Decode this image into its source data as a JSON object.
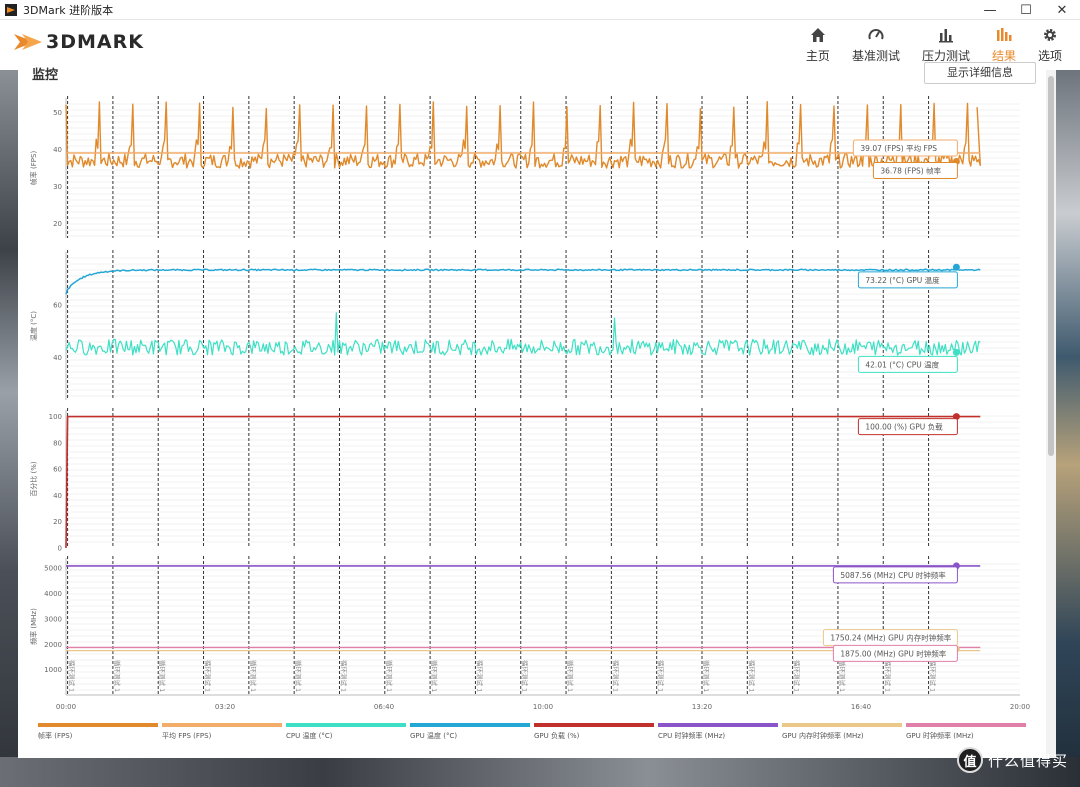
{
  "window": {
    "title": "3DMark 进阶版本",
    "min": "—",
    "max": "☐",
    "close": "✕"
  },
  "header": {
    "logo_text": "3DMARK",
    "nav": [
      {
        "label": "主页",
        "icon": "home-icon"
      },
      {
        "label": "基准测试",
        "icon": "gauge-icon"
      },
      {
        "label": "压力测试",
        "icon": "bars-icon"
      },
      {
        "label": "结果",
        "icon": "results-icon",
        "active": true
      },
      {
        "label": "选项",
        "icon": "gear-icon"
      }
    ]
  },
  "panel": {
    "title": "监控",
    "detail_button": "显示详细信息"
  },
  "colors": {
    "fps": "#e08a2c",
    "avg_fps": "#f2ad6b",
    "cpu_temp": "#3de0c4",
    "gpu_temp": "#25a7d6",
    "gpu_load": "#c0302c",
    "cpu_clock": "#8a55c8",
    "gpu_mem_clock": "#e9c88a",
    "gpu_clock": "#e07fa8",
    "marker_line": "#333333"
  },
  "chart_data": [
    {
      "type": "line",
      "ylabel": "帧率 (FPS)",
      "yticks": [
        20,
        30,
        40,
        50
      ],
      "ylim": [
        16,
        54
      ],
      "series": [
        {
          "name": "帧率 (FPS)",
          "pattern": "periodic spikes",
          "base": 37,
          "spike": 52,
          "period_s": 42
        },
        {
          "name": "平均 FPS (FPS)",
          "values": [
            39.07
          ]
        }
      ],
      "annotations": [
        "39.07 (FPS) 平均 FPS",
        "36.78 (FPS) 帧率"
      ]
    },
    {
      "type": "line",
      "ylabel": "温度 (°C)",
      "yticks": [
        40,
        60
      ],
      "ylim": [
        24,
        80
      ],
      "series": [
        {
          "name": "GPU 温度 (°C)",
          "start": 65,
          "values": [
            73.22
          ]
        },
        {
          "name": "CPU 温度 (°C)",
          "values": [
            42.01
          ]
        }
      ],
      "annotations": [
        "73.22 (°C) GPU 温度",
        "42.01 (°C) CPU 温度"
      ]
    },
    {
      "type": "line",
      "ylabel": "百分比 (%)",
      "yticks": [
        0,
        20,
        40,
        60,
        80,
        100
      ],
      "ylim": [
        0,
        105
      ],
      "series": [
        {
          "name": "GPU 负载 (%)",
          "values": [
            0,
            100
          ]
        }
      ],
      "annotations": [
        "100.00 (%) GPU 负载"
      ]
    },
    {
      "type": "line",
      "ylabel": "频率 (MHz)",
      "yticks": [
        1000,
        2000,
        3000,
        4000,
        5000
      ],
      "ylim": [
        0,
        5400
      ],
      "series": [
        {
          "name": "CPU 时钟频率 (MHz)",
          "values": [
            5087.56
          ]
        },
        {
          "name": "GPU 内存时钟频率 (MHz)",
          "values": [
            1750.24
          ]
        },
        {
          "name": "GPU 时钟频率 (MHz)",
          "values": [
            1875.0
          ]
        }
      ],
      "annotations": [
        "5087.56 (MHz) CPU 时钟频率",
        "1750.24 (MHz) GPU 内存时钟频率",
        "1875.00 (MHz) GPU 时钟频率"
      ]
    }
  ],
  "x_axis": {
    "ticks": [
      "00:00",
      "03:20",
      "06:40",
      "10:00",
      "13:20",
      "16:40",
      "20:00"
    ],
    "end_s": 1200
  },
  "loop_marker_label": "循环测试 1",
  "legend": [
    "帧率 (FPS)",
    "平均 FPS (FPS)",
    "CPU 温度 (°C)",
    "GPU 温度 (°C)",
    "GPU 负载 (%)",
    "CPU 时钟频率 (MHz)",
    "GPU 内存时钟频率 (MHz)",
    "GPU 时钟频率 (MHz)"
  ],
  "watermark": {
    "badge": "值",
    "text": "什么值得买"
  }
}
